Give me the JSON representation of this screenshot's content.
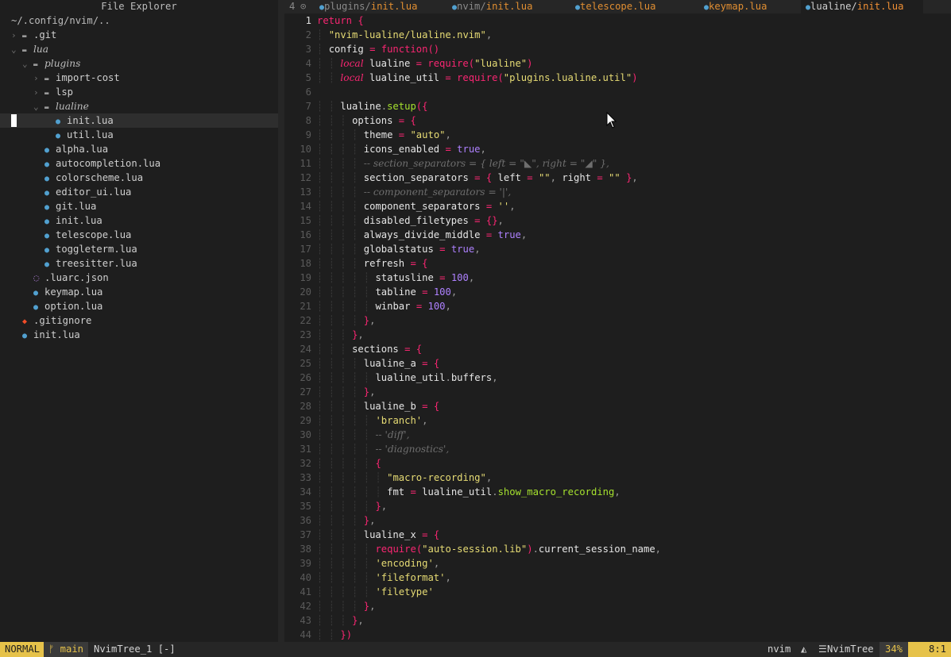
{
  "explorer": {
    "title": "File Explorer",
    "cwd": "~/.config/nvim/..",
    "items": [
      {
        "name": ".git",
        "kind": "folder",
        "depth": 0,
        "open": false,
        "italic": false
      },
      {
        "name": "lua",
        "kind": "folder",
        "depth": 0,
        "open": true,
        "italic": true
      },
      {
        "name": "plugins",
        "kind": "folder",
        "depth": 1,
        "open": true,
        "italic": true
      },
      {
        "name": "import-cost",
        "kind": "folder",
        "depth": 2,
        "open": false,
        "italic": false
      },
      {
        "name": "lsp",
        "kind": "folder",
        "depth": 2,
        "open": false,
        "italic": false
      },
      {
        "name": "lualine",
        "kind": "folder",
        "depth": 2,
        "open": true,
        "italic": true
      },
      {
        "name": "init.lua",
        "kind": "lua",
        "depth": 3,
        "selected": true
      },
      {
        "name": "util.lua",
        "kind": "lua",
        "depth": 3
      },
      {
        "name": "alpha.lua",
        "kind": "lua",
        "depth": 2
      },
      {
        "name": "autocompletion.lua",
        "kind": "lua",
        "depth": 2
      },
      {
        "name": "colorscheme.lua",
        "kind": "lua",
        "depth": 2
      },
      {
        "name": "editor_ui.lua",
        "kind": "lua",
        "depth": 2
      },
      {
        "name": "git.lua",
        "kind": "lua",
        "depth": 2
      },
      {
        "name": "init.lua",
        "kind": "lua",
        "depth": 2
      },
      {
        "name": "telescope.lua",
        "kind": "lua",
        "depth": 2
      },
      {
        "name": "toggleterm.lua",
        "kind": "lua",
        "depth": 2
      },
      {
        "name": "treesitter.lua",
        "kind": "lua",
        "depth": 2
      },
      {
        "name": ".luarc.json",
        "kind": "json",
        "depth": 1
      },
      {
        "name": "keymap.lua",
        "kind": "lua",
        "depth": 1
      },
      {
        "name": "option.lua",
        "kind": "lua",
        "depth": 1
      },
      {
        "name": ".gitignore",
        "kind": "git",
        "depth": 0
      },
      {
        "name": "init.lua",
        "kind": "lua",
        "depth": 0
      }
    ]
  },
  "tabs": {
    "buffer_count": "4",
    "items": [
      {
        "dir": "plugins/",
        "name": "init.lua",
        "active": false
      },
      {
        "dir": "nvim/",
        "name": "init.lua",
        "active": false
      },
      {
        "dir": "",
        "name": "telescope.lua",
        "active": false
      },
      {
        "dir": "",
        "name": "keymap.lua",
        "active": false
      },
      {
        "dir": "lualine/",
        "name": "init.lua",
        "active": true
      }
    ]
  },
  "editor": {
    "current_line": 1,
    "lines": [
      "return {",
      "  \"nvim-lualine/lualine.nvim\",",
      "  config = function()",
      "    local lualine = require(\"lualine\")",
      "    local lualine_util = require(\"plugins.lualine.util\")",
      "",
      "    lualine.setup({",
      "      options = {",
      "        theme = \"auto\",",
      "        icons_enabled = true,",
      "        -- section_separators = { left = \"◣\", right = \"◢\" },",
      "        section_separators = { left = \"\", right = \"\" },",
      "        -- component_separators = '|',",
      "        component_separators = '',",
      "        disabled_filetypes = {},",
      "        always_divide_middle = true,",
      "        globalstatus = true,",
      "        refresh = {",
      "          statusline = 100,",
      "          tabline = 100,",
      "          winbar = 100,",
      "        },",
      "      },",
      "      sections = {",
      "        lualine_a = {",
      "          lualine_util.buffers,",
      "        },",
      "        lualine_b = {",
      "          'branch',",
      "          -- 'diff',",
      "          -- 'diagnostics',",
      "          {",
      "            \"macro-recording\",",
      "            fmt = lualine_util.show_macro_recording,",
      "          },",
      "        },",
      "        lualine_x = {",
      "          require(\"auto-session.lib\").current_session_name,",
      "          'encoding',",
      "          'fileformat',",
      "          'filetype'",
      "        },",
      "      },",
      "    })"
    ]
  },
  "statusline": {
    "mode": "NORMAL",
    "branch": "main",
    "file": "NvimTree_1 [-]",
    "app": "nvim",
    "filetype": "NvimTree",
    "percent": "34%",
    "position": "8:1"
  },
  "colors": {
    "accent": "#e6c24a",
    "lua_icon": "#51a0cf",
    "tab_name": "#e08e32",
    "background": "#1e1e1e"
  }
}
